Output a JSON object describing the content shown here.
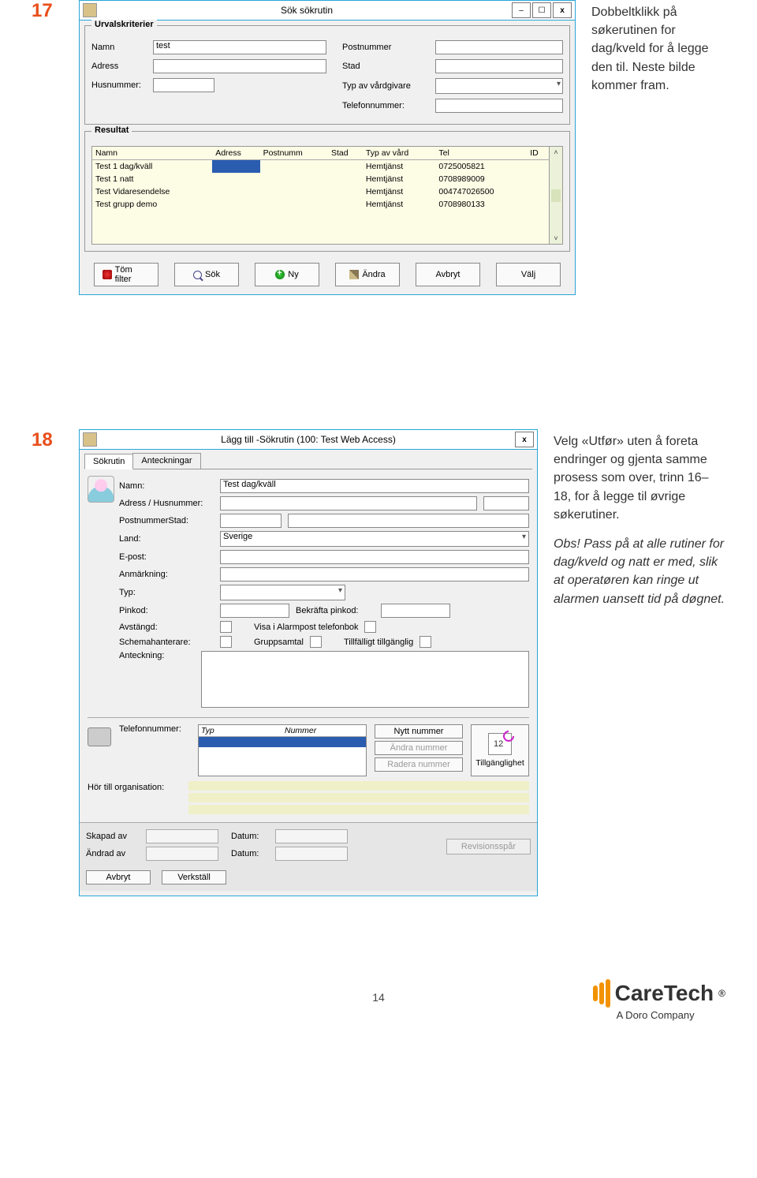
{
  "steps": {
    "s17": "17",
    "s18": "18"
  },
  "side17": "Dobbeltklikk på søkerutinen for dag/kveld for å legge den til. Neste bilde kommer fram.",
  "side18_p1a": "Velg «",
  "side18_p1b": "Utfør",
  "side18_p1c": "» uten å foreta endringer og gjenta samme prosess som over, trinn 16–18, for å legge til øvrige søkerutiner.",
  "side18_p2": "Obs! Pass på at alle rutiner for dag/kveld og natt er med, slik at operatøren kan ringe ut alarmen uansett tid på døgnet.",
  "win1": {
    "title": "Sök sökrutin",
    "group1": "Urvalskriterier",
    "labels": {
      "namn": "Namn",
      "adress": "Adress",
      "husnr": "Husnummer:",
      "postnr": "Postnummer",
      "stad": "Stad",
      "typv": "Typ av vårdgivare",
      "tel": "Telefonnummer:"
    },
    "namn_val": "test",
    "group2": "Resultat",
    "cols": {
      "namn": "Namn",
      "adress": "Adress",
      "postnr": "Postnumm",
      "stad": "Stad",
      "typ": "Typ av vård",
      "tel": "Tel",
      "id": "ID"
    },
    "rows": [
      {
        "namn": "Test 1 dag/kväll",
        "typ": "Hemtjänst",
        "tel": "0725005821"
      },
      {
        "namn": "Test 1 natt",
        "typ": "Hemtjänst",
        "tel": "0708989009"
      },
      {
        "namn": "Test Vidaresendelse",
        "typ": "Hemtjänst",
        "tel": "004747026500"
      },
      {
        "namn": "Test grupp demo",
        "typ": "Hemtjänst",
        "tel": "0708980133"
      }
    ],
    "btns": {
      "tom": "Töm filter",
      "sok": "Sök",
      "ny": "Ny",
      "andra": "Ändra",
      "avbryt": "Avbryt",
      "valj": "Välj"
    }
  },
  "win2": {
    "title": "Lägg till -Sökrutin (100: Test Web Access)",
    "tabs": {
      "t1": "Sökrutin",
      "t2": "Anteckningar"
    },
    "labels": {
      "namn": "Namn:",
      "adress": "Adress / Husnummer:",
      "poststad": "PostnummerStad:",
      "land": "Land:",
      "epost": "E-post:",
      "anm": "Anmärkning:",
      "typ": "Typ:",
      "pin": "Pinkod:",
      "bpin": "Bekräfta pinkod:",
      "avst": "Avstängd:",
      "visa": "Visa i Alarmpost telefonbok",
      "schema": "Schemahanterare:",
      "grupp": "Gruppsamtal",
      "tillf": "Tillfälligt tillgänglig",
      "anteck": "Anteckning:",
      "telnr": "Telefonnummer:",
      "typcol": "Typ",
      "numcol": "Nummer",
      "nytt": "Nytt nummer",
      "andranr": "Ändra nummer",
      "radera": "Radera nummer",
      "tilg": "Tillgänglighet",
      "org": "Hör till organisation:",
      "skapad": "Skapad av",
      "andrad": "Ändrad av",
      "datum": "Datum:",
      "rev": "Revisionsspår",
      "avbryt": "Avbryt",
      "verkstall": "Verkställ"
    },
    "namn_val": "Test dag/kväll",
    "land_val": "Sverige"
  },
  "footer": {
    "page": "14"
  },
  "logo": {
    "name": "CareTech",
    "sub": "A Doro Company"
  }
}
